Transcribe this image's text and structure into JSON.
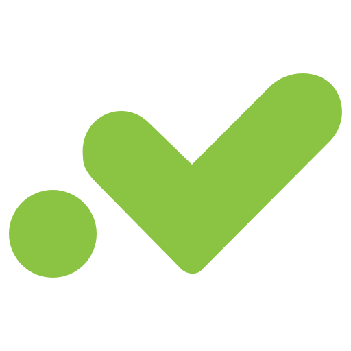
{
  "logo": {
    "name": "green-check-logo",
    "shapes": [
      "dot-icon",
      "checkmark-icon"
    ]
  },
  "colors": {
    "background": "#ffffff",
    "accent": "#8bc443"
  }
}
